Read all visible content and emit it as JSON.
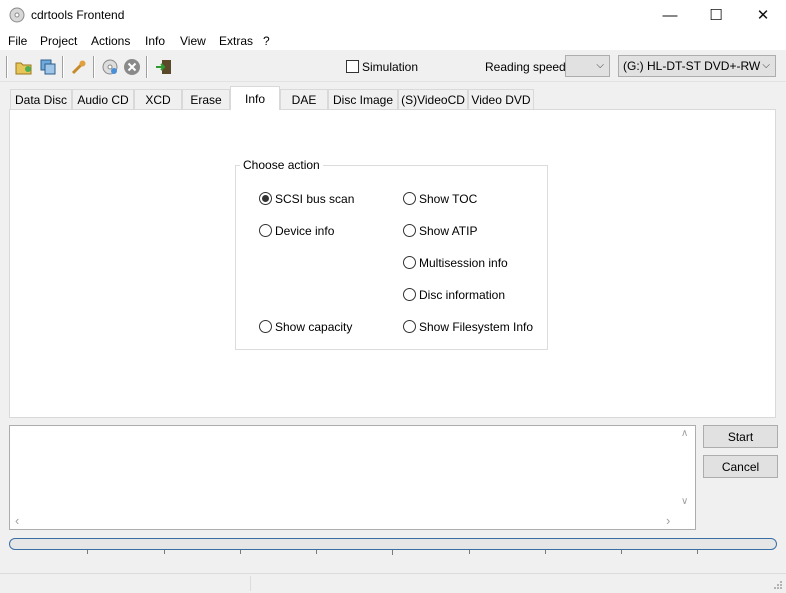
{
  "window": {
    "title": "cdrtools Frontend",
    "minimize_glyph": "—",
    "maximize_glyph": "☐",
    "close_glyph": "✕"
  },
  "menu": [
    "File",
    "Project",
    "Actions",
    "Info",
    "View",
    "Extras",
    "?"
  ],
  "toolbar": {
    "simulation_label": "Simulation",
    "simulation_checked": false,
    "reading_speed_label": "Reading speed",
    "reading_speed_value": "",
    "drive_value": "(G:) HL-DT-ST DVD+-RW",
    "icons": [
      "open-folder-icon",
      "copy-disc-icon",
      "settings-wrench-icon",
      "burn-disc-icon",
      "stop-icon",
      "exit-icon"
    ]
  },
  "tabs": [
    "Data Disc",
    "Audio CD",
    "XCD",
    "Erase",
    "Info",
    "DAE",
    "Disc Image",
    "(S)VideoCD",
    "Video DVD"
  ],
  "active_tab": "Info",
  "choose_action": {
    "label": "Choose action",
    "options": [
      {
        "label": "SCSI bus scan",
        "checked": true
      },
      {
        "label": "Device info",
        "checked": false
      },
      {
        "label": "Show capacity",
        "checked": false
      },
      {
        "label": "Show TOC",
        "checked": false
      },
      {
        "label": "Show ATIP",
        "checked": false
      },
      {
        "label": "Multisession info",
        "checked": false
      },
      {
        "label": "Disc information",
        "checked": false
      },
      {
        "label": "Show Filesystem Info",
        "checked": false
      }
    ]
  },
  "buttons": {
    "start": "Start",
    "cancel": "Cancel"
  },
  "scroll_arrows": {
    "up": "∧",
    "down": "∨",
    "left": "‹",
    "right": "›"
  },
  "colors": {
    "progress_border": "#3a6ea5"
  }
}
